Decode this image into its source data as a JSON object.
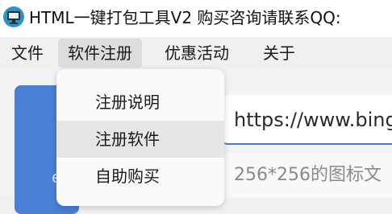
{
  "window": {
    "title": "HTML一键打包工具V2 购买咨询请联系QQ:"
  },
  "menubar": {
    "items": [
      {
        "label": "文件"
      },
      {
        "label": "软件注册"
      },
      {
        "label": "优惠活动"
      },
      {
        "label": "关于"
      }
    ]
  },
  "dropdown": {
    "items": [
      {
        "label": "注册说明"
      },
      {
        "label": "注册软件"
      },
      {
        "label": "自助购买"
      }
    ]
  },
  "main": {
    "url_value": "https://www.bing",
    "icon_placeholder": "256*256的图标文",
    "panel_glyph": "e"
  },
  "colors": {
    "accent": "#3f7fd8",
    "panel": "#4a7fd6"
  },
  "icons": {
    "app": "monitor-icon"
  }
}
